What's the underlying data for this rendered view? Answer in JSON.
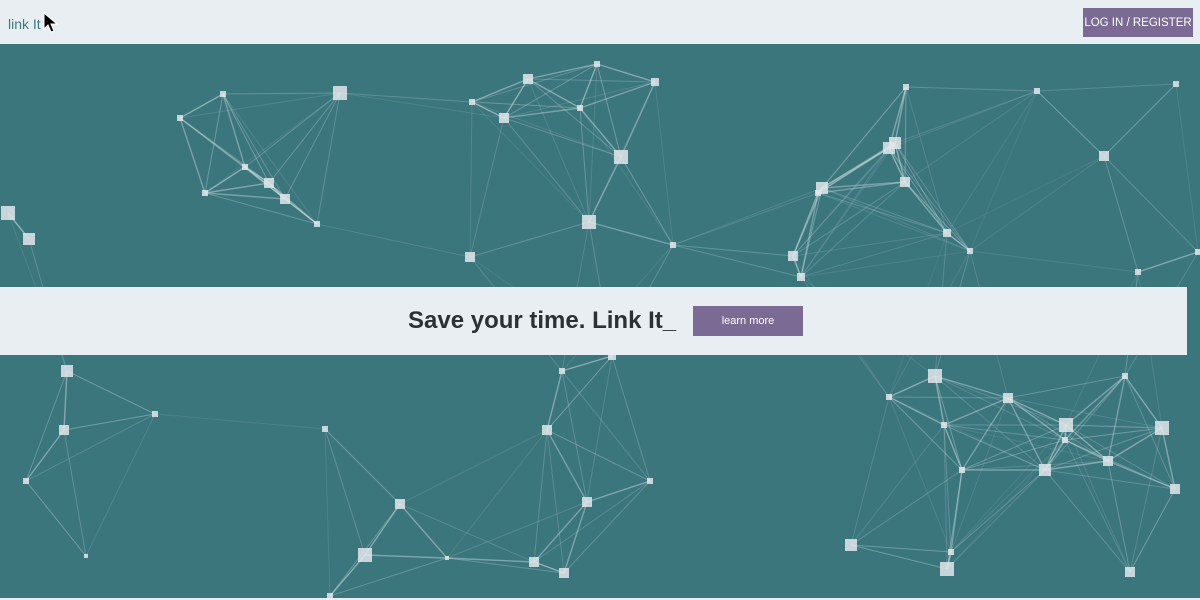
{
  "header": {
    "logo_text": "link It",
    "login_label": "LOG IN / REGISTER"
  },
  "hero": {
    "headline": "Save your time. Link It_",
    "cta_label": "learn more"
  },
  "colors": {
    "accent": "#7b6a93",
    "hero_background": "#3c767d",
    "bar_background": "#e8eef1",
    "logo_text": "#3a7b80",
    "headline_text": "#2c3136"
  },
  "icons": {
    "cursor": "cursor-icon",
    "network": "network-graph"
  }
}
